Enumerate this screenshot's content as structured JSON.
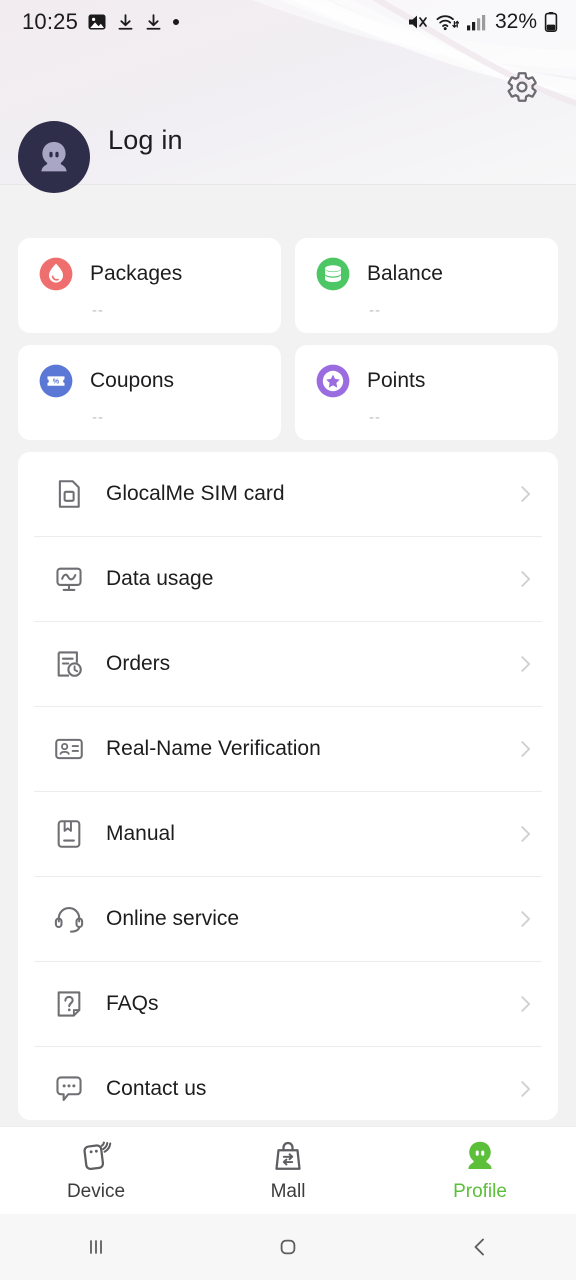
{
  "status_bar": {
    "time": "10:25",
    "battery": "32%",
    "left_icons": [
      "image-icon",
      "download-icon",
      "download-icon",
      "dot-icon"
    ],
    "right_icons": [
      "mute-icon",
      "wifi-icon",
      "signal-icon",
      "battery-icon"
    ]
  },
  "header": {
    "login_label": "Log in",
    "settings_icon": "gear-icon",
    "avatar_icon": "person-avatar-icon"
  },
  "quick_cards": [
    {
      "label": "Packages",
      "value": "--",
      "icon": "packages-drop-icon",
      "color": "#ef6e6e"
    },
    {
      "label": "Balance",
      "value": "--",
      "icon": "balance-coins-icon",
      "color": "#4cc764"
    },
    {
      "label": "Coupons",
      "value": "--",
      "icon": "coupon-ticket-icon",
      "color": "#5b78d6"
    },
    {
      "label": "Points",
      "value": "--",
      "icon": "points-star-icon",
      "color": "#9b6ce0"
    }
  ],
  "menu": [
    {
      "label": "GlocalMe SIM card",
      "icon": "sim-card-icon"
    },
    {
      "label": "Data usage",
      "icon": "data-usage-monitor-icon"
    },
    {
      "label": "Orders",
      "icon": "orders-clock-icon"
    },
    {
      "label": "Real-Name Verification",
      "icon": "id-card-icon"
    },
    {
      "label": "Manual",
      "icon": "manual-book-icon"
    },
    {
      "label": "Online service",
      "icon": "headset-icon"
    },
    {
      "label": "FAQs",
      "icon": "faq-question-icon"
    },
    {
      "label": "Contact us",
      "icon": "chat-bubble-icon"
    }
  ],
  "bottom_nav": {
    "active_color": "#5cbf3a",
    "items": [
      {
        "label": "Device",
        "icon": "hotspot-device-icon",
        "active": false
      },
      {
        "label": "Mall",
        "icon": "shopping-bag-icon",
        "active": false
      },
      {
        "label": "Profile",
        "icon": "profile-person-icon",
        "active": true
      }
    ]
  },
  "system_nav": {
    "recents_icon": "recents-icon",
    "home_icon": "home-icon",
    "back_icon": "back-icon"
  }
}
